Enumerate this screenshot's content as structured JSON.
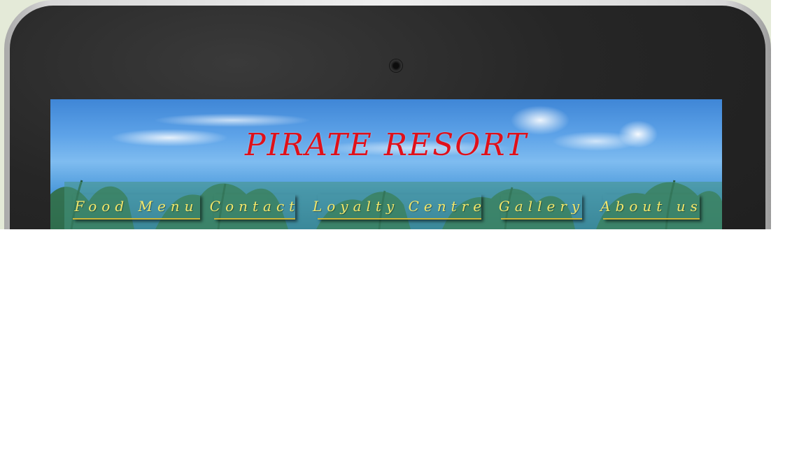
{
  "site": {
    "title": "PIRATE RESORT"
  },
  "nav": {
    "items": [
      {
        "label": "Food Menu"
      },
      {
        "label": "Contact"
      },
      {
        "label": "Loyalty Centre"
      },
      {
        "label": "Gallery"
      },
      {
        "label": "About us"
      }
    ]
  },
  "colors": {
    "title": "#e0101a",
    "nav_text": "#f3e76a",
    "nav_band": "#469682",
    "sky": "#5ea3e8",
    "tablet_bezel": "#262626"
  }
}
